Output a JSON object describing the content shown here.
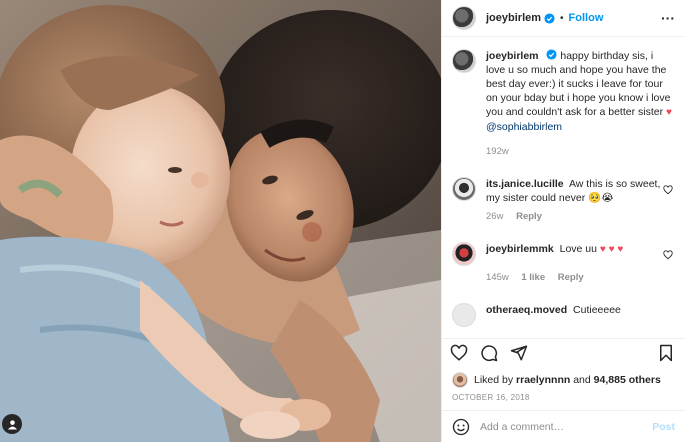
{
  "post": {
    "username": "joeybirlem",
    "verified": true,
    "follow_label": "Follow",
    "dot": "•",
    "more_label": "···",
    "caption": {
      "username": "joeybirlem",
      "text": "happy birthday sis, i love u so much and hope you have the best day ever:) it sucks i leave for tour on your bday but i hope you know i love you and couldn't ask for a better sister",
      "heart": "♥",
      "mention": "@sophiabbirlem",
      "time": "192w"
    },
    "comments": [
      {
        "username": "its.janice.lucille",
        "text": "Aw this is so sweet, my sister could never 🥺😭",
        "time": "26w",
        "likes": "",
        "reply": "Reply"
      },
      {
        "username": "joeybirlemmk",
        "text": "Love uu",
        "hearts": "♥ ♥ ♥",
        "time": "145w",
        "likes": "1 like",
        "reply": "Reply"
      },
      {
        "username": "otheraeq.moved",
        "text": "Cutieeeee",
        "time": "",
        "likes": "",
        "reply": ""
      }
    ],
    "liked_by": {
      "prefix": "Liked by",
      "user": "rraelynnnn",
      "conjunction": "and",
      "count": "94,885 others"
    },
    "date": "OCTOBER 16, 2018",
    "add_comment_placeholder": "Add a comment…",
    "post_button": "Post"
  },
  "colors": {
    "accent": "#0095f6",
    "heart": "#ed4956",
    "muted": "#8e8e8e",
    "post_disabled": "#b2dffc"
  },
  "icons": [
    "more-icon",
    "verified-icon",
    "heart-icon",
    "comment-icon",
    "share-icon",
    "bookmark-icon",
    "emoji-icon",
    "account-icon"
  ]
}
